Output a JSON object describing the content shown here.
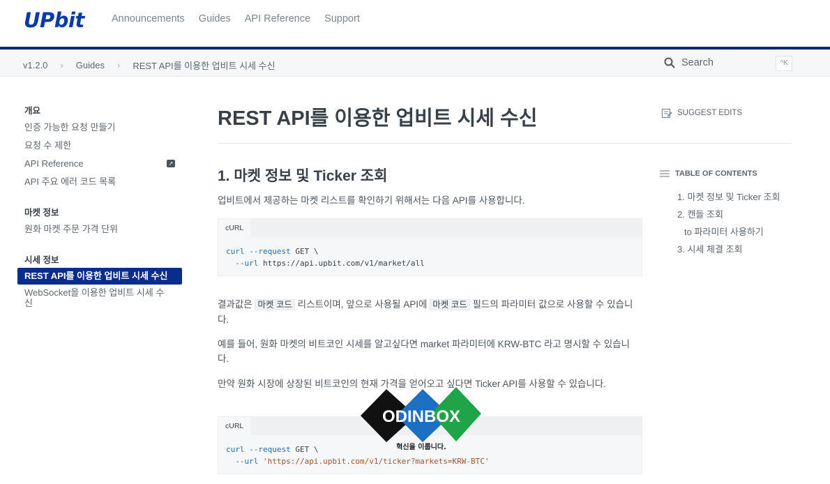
{
  "header": {
    "logo": "UPbit",
    "nav": [
      "Announcements",
      "Guides",
      "API Reference",
      "Support"
    ]
  },
  "breadcrumb": [
    "v1.2.0",
    "Guides",
    "REST API를 이용한 업비트 시세 수신"
  ],
  "search": {
    "placeholder": "Search",
    "shortcut": "^K"
  },
  "sidebar": {
    "sections": [
      {
        "title": "개요",
        "items": [
          "인증 가능한 요청 만들기",
          "요청 수 제한",
          "API Reference",
          "API 주요 에러 코드 목록"
        ]
      },
      {
        "title": "마켓 정보",
        "items": [
          "원화 마켓 주문 가격 단위"
        ]
      },
      {
        "title": "시세 정보",
        "items": [
          "REST API를 이용한 업비트 시세 수신",
          "WebSocket을 이용한 업비트 시세 수신"
        ]
      }
    ]
  },
  "main": {
    "title": "REST API를 이용한 업비트 시세 수신",
    "section1": "1. 마켓 정보 및 Ticker 조회",
    "p1": "업비트에서 제공하는 마켓 리스트를 확인하기 위해서는 다음 API를 사용합니다.",
    "code_tab": "cURL",
    "code1": {
      "line1_cmd": "curl --request",
      "line1_rest": " GET \\",
      "line2_opt": "  --url",
      "line2_rest": " https://api.upbit.com/v1/market/all"
    },
    "p2_a": "결과값은 ",
    "p2_code1": "마켓 코드",
    "p2_b": " 리스트이며, 앞으로 사용될 API에 ",
    "p2_code2": "마켓 코드",
    "p2_c": " 필드의 파라미터 값으로 사용할 수 있습니다.",
    "p3": "예를 들어, 원화 마켓의 비트코인 시세를 알고싶다면 market 파라미터에 KRW-BTC 라고 명시할 수 있습니다.",
    "p4": "만약 원화 시장에 상장된 비트코인의 현재 가격을 얻어오고 싶다면 Ticker API를 사용할 수 있습니다.",
    "code2": {
      "line1_cmd": "curl --request",
      "line1_rest": " GET \\",
      "line2_opt": "  --url",
      "line2_rest": " 'https://api.upbit.com/v1/ticker?markets=KRW-BTC'"
    }
  },
  "right": {
    "suggest": "SUGGEST EDITS",
    "toc_title": "TABLE OF CONTENTS",
    "toc": [
      "1. 마켓 정보 및 Ticker 조회",
      "2. 캔들 조회",
      "to 파라미터 사용하기",
      "3. 시세 체결 조회"
    ]
  },
  "watermark": {
    "brand": "ODINBOX",
    "tagline": "혁신을 이룹니다."
  },
  "colors": {
    "brand_blue": "#0a2d8c",
    "rule_blue": "#0a2a7a"
  }
}
